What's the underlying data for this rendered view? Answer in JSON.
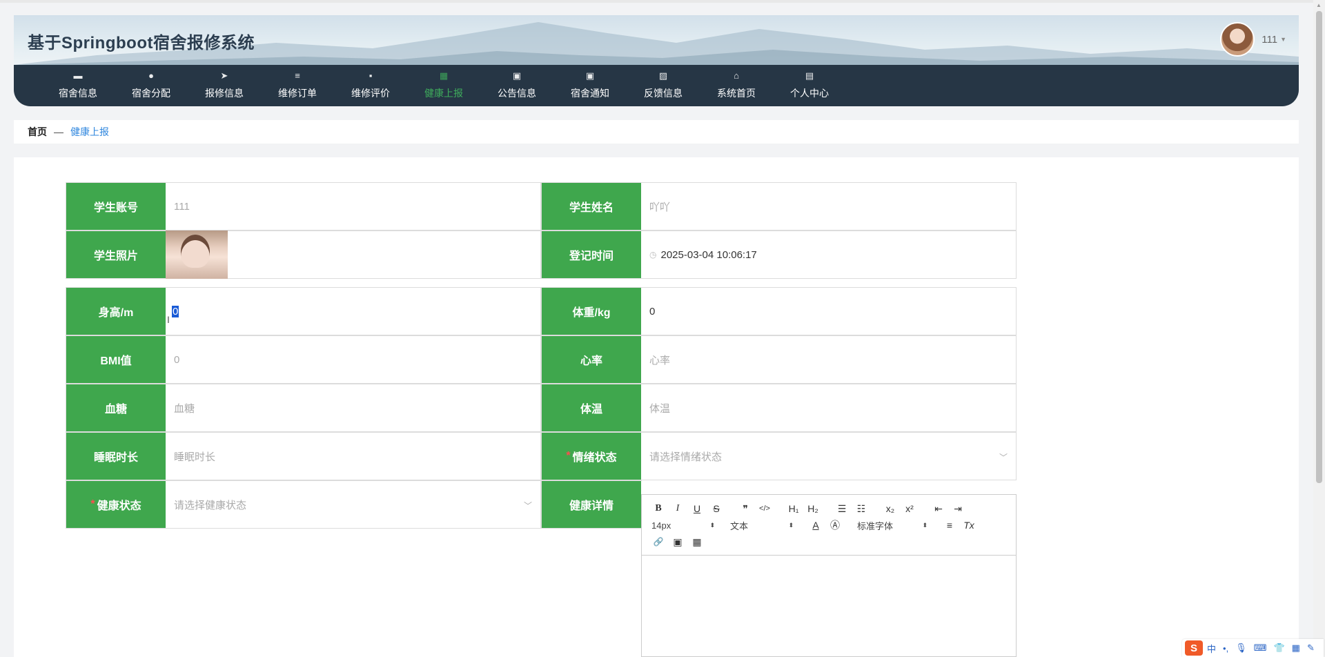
{
  "app": {
    "title": "基于Springboot宿舍报修系统"
  },
  "user": {
    "name": "111"
  },
  "nav": {
    "items": [
      {
        "label": "宿舍信息",
        "icon": "▬",
        "active": false
      },
      {
        "label": "宿舍分配",
        "icon": "●",
        "active": false
      },
      {
        "label": "报修信息",
        "icon": "➤",
        "active": false
      },
      {
        "label": "维修订单",
        "icon": "≡",
        "active": false
      },
      {
        "label": "维修评价",
        "icon": "▪",
        "active": false
      },
      {
        "label": "健康上报",
        "icon": "▦",
        "active": true
      },
      {
        "label": "公告信息",
        "icon": "▣",
        "active": false
      },
      {
        "label": "宿舍通知",
        "icon": "▣",
        "active": false
      },
      {
        "label": "反馈信息",
        "icon": "▨",
        "active": false
      },
      {
        "label": "系统首页",
        "icon": "⌂",
        "active": false
      },
      {
        "label": "个人中心",
        "icon": "▤",
        "active": false
      }
    ]
  },
  "breadcrumb": {
    "home": "首页",
    "separator": "—",
    "current": "健康上报"
  },
  "form": {
    "student_account": {
      "label": "学生账号",
      "value": "111"
    },
    "student_name": {
      "label": "学生姓名",
      "value": "吖吖"
    },
    "student_photo": {
      "label": "学生照片"
    },
    "register_time": {
      "label": "登记时间",
      "value": "2025-03-04 10:06:17"
    },
    "height": {
      "label": "身高/m",
      "value": "0"
    },
    "weight": {
      "label": "体重/kg",
      "value": "0"
    },
    "bmi": {
      "label": "BMI值",
      "value": "0"
    },
    "heart_rate": {
      "label": "心率",
      "placeholder": "心率"
    },
    "blood_sugar": {
      "label": "血糖",
      "placeholder": "血糖"
    },
    "body_temp": {
      "label": "体温",
      "placeholder": "体温"
    },
    "sleep_duration": {
      "label": "睡眠时长",
      "placeholder": "睡眠时长"
    },
    "mood": {
      "label": "情绪状态",
      "required_mark": "*",
      "placeholder": "请选择情绪状态"
    },
    "health_status": {
      "label": "健康状态",
      "required_mark": "*",
      "placeholder": "请选择健康状态"
    },
    "health_detail": {
      "label": "健康详情"
    }
  },
  "editor": {
    "font_size": "14px",
    "text_style": "文本",
    "font_family": "标准字体",
    "buttons": {
      "bold": "B",
      "italic": "I",
      "underline": "U",
      "strike": "S",
      "quote": "❞",
      "code": "</>",
      "h1": "H₁",
      "h2": "H₂",
      "ordered_list": "☰",
      "bullet_list": "☷",
      "subscript": "x₂",
      "superscript": "x²",
      "outdent": "⇤",
      "indent": "⇥",
      "font_color": "A",
      "background": "Ⓐ",
      "align": "≡",
      "clean": "Tx",
      "link": "🔗",
      "image": "▣",
      "video": "▦"
    }
  },
  "ime": {
    "logo": "S",
    "lang": "中",
    "punct": "•,",
    "mic": "🎙",
    "keyboard": "⌨",
    "skin": "👕",
    "apps": "▦",
    "tool": "✎"
  },
  "colors": {
    "accent_green": "#3fa74d",
    "nav_bg": "#263645",
    "active_nav": "#3fae5c",
    "link_blue": "#2e86de"
  }
}
